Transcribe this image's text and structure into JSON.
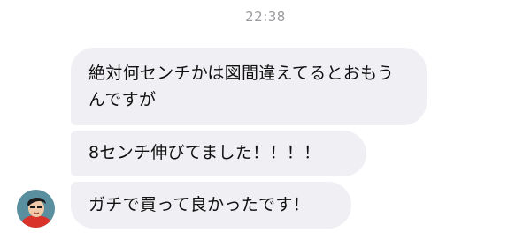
{
  "conversation": {
    "timestamp": "22:38",
    "messages": [
      {
        "text": "絶対何センチかは図間違えてるとおもうんですが"
      },
      {
        "text": "8センチ伸びてました！！！！"
      },
      {
        "text": "ガチで買って良かったです！"
      }
    ]
  },
  "colors": {
    "bubble_background": "#f0f0f4",
    "timestamp_text": "#9a9a9e",
    "message_text": "#111111",
    "avatar_background": "#5a8fa0"
  },
  "icons": {
    "avatar": "sender-avatar"
  }
}
